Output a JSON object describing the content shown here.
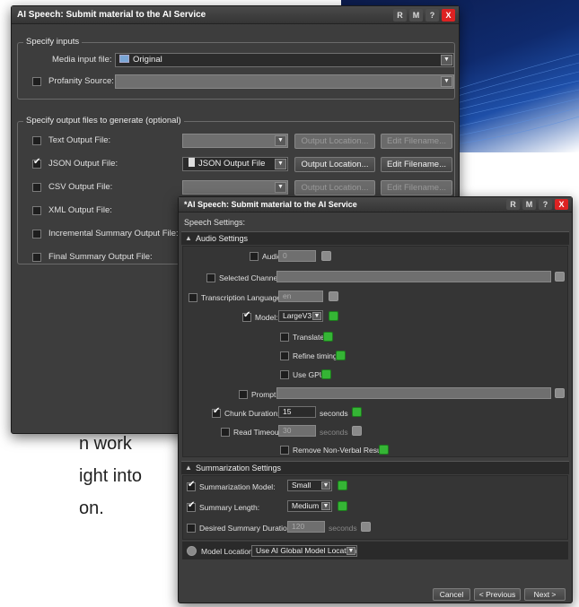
{
  "background": {
    "lines": [
      "n work",
      "ight into",
      "on."
    ]
  },
  "win1": {
    "title": "AI Speech: Submit material to the AI Service",
    "buttons": [
      "R",
      "M",
      "?",
      "X"
    ],
    "inputs_group": "Specify inputs",
    "media_input_label": "Media input file:",
    "media_input_value": "Original",
    "profanity_label": "Profanity Source:",
    "outputs_group": "Specify output files to generate (optional)",
    "rows": [
      {
        "label": "Text Output File:",
        "checked": false,
        "value": "",
        "loc": "Output Location...",
        "edit": "Edit Filename..."
      },
      {
        "label": "JSON Output File:",
        "checked": true,
        "value": "JSON Output File",
        "loc": "Output Location...",
        "edit": "Edit Filename..."
      },
      {
        "label": "CSV Output File:",
        "checked": false,
        "value": "",
        "loc": "Output Location...",
        "edit": "Edit Filename..."
      },
      {
        "label": "XML Output File:",
        "checked": false
      },
      {
        "label": "Incremental Summary Output File:",
        "checked": false
      },
      {
        "label": "Final Summary Output File:",
        "checked": false
      }
    ]
  },
  "win2": {
    "title": "*AI Speech: Submit material to the AI Service",
    "buttons": [
      "R",
      "M",
      "?",
      "X"
    ],
    "header": "Speech Settings:",
    "audio": {
      "title": "Audio Settings",
      "audio_track": "Audio Track:",
      "audio_track_value": "0",
      "selected_channels": "Selected Channels:",
      "transcription_language": "Transcription Language:",
      "transcription_language_value": "en",
      "model": "Model:",
      "model_value": "LargeV3",
      "translate": "Translate",
      "refine_timing": "Refine timing",
      "use_gpu": "Use GPU",
      "prompt": "Prompt:",
      "chunk_duration": "Chunk Duration:",
      "chunk_duration_value": "15",
      "chunk_unit": "seconds",
      "read_timeout": "Read Timeout:",
      "read_timeout_value": "30",
      "read_timeout_unit": "seconds",
      "remove_nonverbal": "Remove Non-Verbal Results"
    },
    "summ": {
      "title": "Summarization Settings",
      "model": "Summarization Model:",
      "model_value": "Small",
      "length": "Summary Length:",
      "length_value": "Medium",
      "desired": "Desired Summary Duration:",
      "desired_value": "120",
      "desired_unit": "seconds"
    },
    "model_location": {
      "label": "Model Location:",
      "value": "Use AI Global Model Location"
    },
    "footer": {
      "cancel": "Cancel",
      "previous": "< Previous",
      "next": "Next >"
    }
  }
}
